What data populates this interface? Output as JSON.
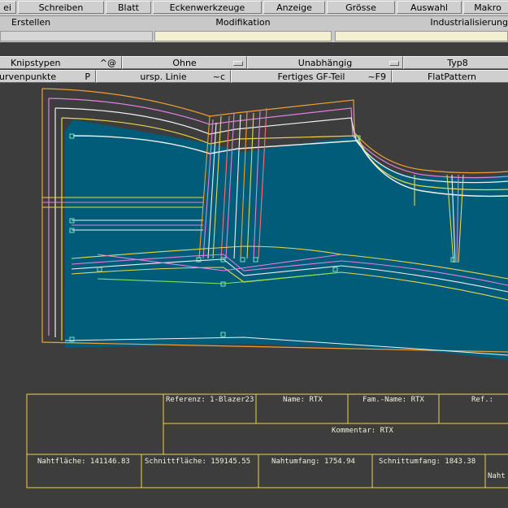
{
  "menu": {
    "items": [
      "ei",
      "Schreiben",
      "Blatt",
      "Eckenwerkzeuge",
      "Anzeige",
      "Grösse",
      "Auswahl",
      "Makro"
    ]
  },
  "toolbar2": {
    "create": "Erstellen",
    "modification": "Modifikation",
    "industrialization": "Industrialisierung"
  },
  "toolbar3": {
    "knip": "Knipstypen",
    "knip_shortcut": "^@",
    "ohne": "Ohne",
    "independent": "Unabhängig",
    "type": "Typ8"
  },
  "toolbar4": {
    "curve_points": "urvenpunkte",
    "curve_points_shortcut": "P",
    "orig_line": "ursp. Linie",
    "orig_line_shortcut": "~c",
    "finished_part": "Fertiges GF-Teil",
    "finished_part_shortcut": "~F9",
    "flat_pattern": "FlatPattern"
  },
  "title_block": {
    "reference": "Referenz: 1-Blazer23",
    "name": "Name: RTX",
    "family_name": "Fam.-Name: RTX",
    "ref": "Ref.:",
    "comment": "Kommentar: RTX",
    "seam_area": "Nahtfläche: 141146.83",
    "cut_area": "Schnittfläche: 159145.55",
    "seam_perimeter": "Nahtumfang: 1754.94",
    "cut_perimeter": "Schnittumfang: 1843.38",
    "naht_cut": "Naht"
  },
  "colors": {
    "piece_fill": "#005c78",
    "outline_yellow": "#e8d84a",
    "line_magenta": "#e080e0",
    "line_orange": "#f0a030",
    "line_white": "#f0f0f0",
    "line_pink": "#ff7070",
    "line_green": "#80e060",
    "grid_white": "#e8e8e8"
  }
}
